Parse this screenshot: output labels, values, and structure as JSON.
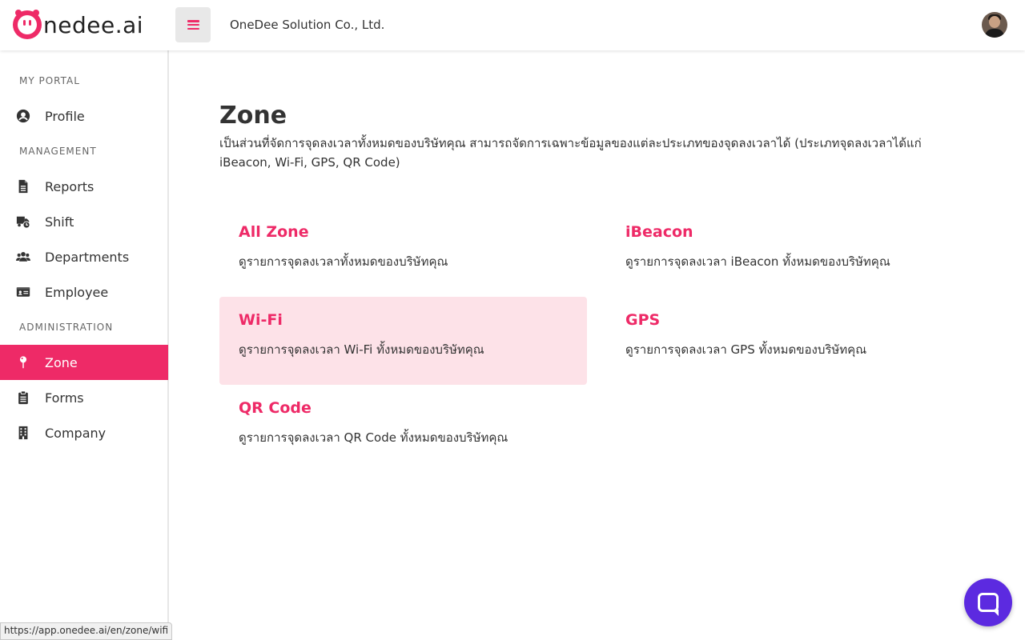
{
  "header": {
    "logo_text": "nedee.ai",
    "company_name": "OneDee Solution Co., Ltd."
  },
  "sidebar": {
    "sections": [
      {
        "title": "MY PORTAL"
      },
      {
        "title": "MANAGEMENT"
      },
      {
        "title": "ADMINISTRATION"
      }
    ],
    "items": [
      {
        "label": "Profile",
        "icon": "user-circle-icon"
      },
      {
        "label": "Reports",
        "icon": "file-icon"
      },
      {
        "label": "Shift",
        "icon": "truck-clock-icon"
      },
      {
        "label": "Departments",
        "icon": "users-icon"
      },
      {
        "label": "Employee",
        "icon": "id-card-icon"
      },
      {
        "label": "Zone",
        "icon": "map-pin-icon",
        "active": true
      },
      {
        "label": "Forms",
        "icon": "clipboard-icon"
      },
      {
        "label": "Company",
        "icon": "building-icon"
      }
    ]
  },
  "main": {
    "title": "Zone",
    "description": "เป็นส่วนที่จัดการจุดลงเวลาทั้งหมดของบริษัทคุณ สามารถจัดการเฉพาะข้อมูลของแต่ละประเภทของจุดลงเวลาได้ (ประเภทจุดลงเวลาได้แก่ iBeacon, Wi-Fi, GPS, QR Code)",
    "cards": [
      {
        "title": "All Zone",
        "desc": "ดูรายการจุดลงเวลาทั้งหมดของบริษัทคุณ"
      },
      {
        "title": "iBeacon",
        "desc": "ดูรายการจุดลงเวลา iBeacon ทั้งหมดของบริษัทคุณ"
      },
      {
        "title": "Wi-Fi",
        "desc": "ดูรายการจุดลงเวลา Wi-Fi ทั้งหมดของบริษัทคุณ"
      },
      {
        "title": "GPS",
        "desc": "ดูรายการจุดลงเวลา GPS ทั้งหมดของบริษัทคุณ"
      },
      {
        "title": "QR Code",
        "desc": "ดูรายการจุดลงเวลา QR Code ทั้งหมดของบริษัทคุณ"
      }
    ]
  },
  "status_bar": {
    "url": "https://app.onedee.ai/en/zone/wifi"
  },
  "colors": {
    "accent": "#ee2a67",
    "hover_card": "#fde2e8",
    "chat": "#5c2ae0"
  }
}
